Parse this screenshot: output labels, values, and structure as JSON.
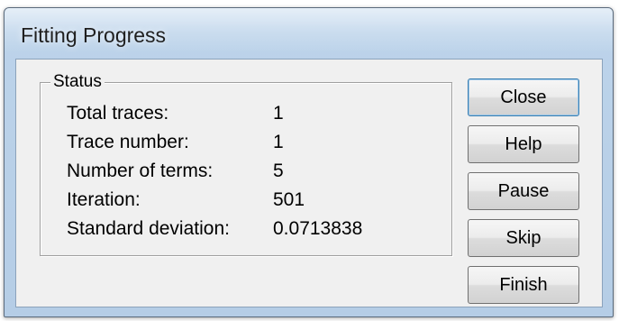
{
  "window": {
    "title": "Fitting Progress"
  },
  "status": {
    "group_label": "Status",
    "rows": [
      {
        "label": "Total traces:",
        "value": "1"
      },
      {
        "label": "Trace number:",
        "value": "1"
      },
      {
        "label": "Number of terms:",
        "value": "5"
      },
      {
        "label": "Iteration:",
        "value": "501"
      },
      {
        "label": "Standard deviation:",
        "value": "0.0713838"
      }
    ]
  },
  "buttons": {
    "close": "Close",
    "help": "Help",
    "pause": "Pause",
    "skip": "Skip",
    "finish": "Finish"
  }
}
